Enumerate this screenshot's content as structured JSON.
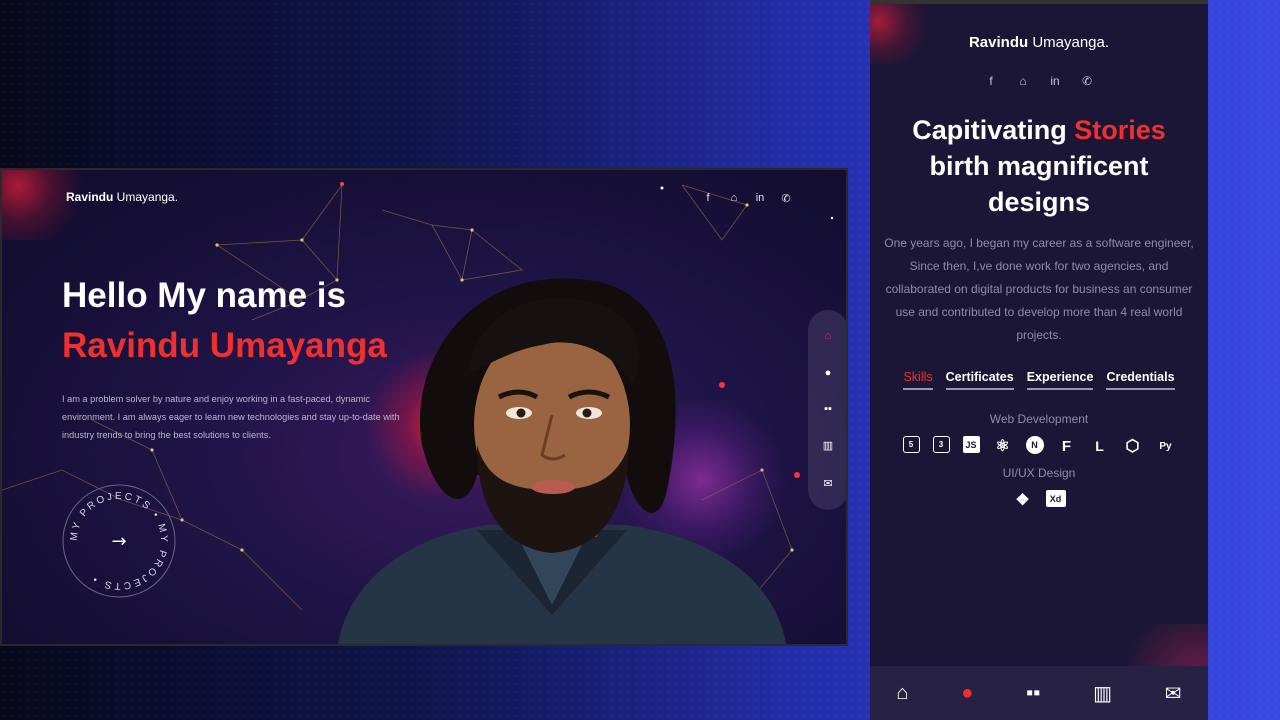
{
  "brand": {
    "first": "Ravindu",
    "last": " Umayanga."
  },
  "social_icons": [
    "facebook-icon",
    "github-icon",
    "linkedin-icon",
    "whatsapp-icon"
  ],
  "social_glyphs": {
    "facebook": "f",
    "github": "⌂",
    "linkedin": "in",
    "whatsapp": "✆"
  },
  "desktop": {
    "hero": {
      "hello": "Hello My name is",
      "name": "Ravindu Umayanga",
      "description": "I am a problem solver by nature and enjoy working in a fast-paced, dynamic environment. I am always eager to learn new technologies and stay up-to-date with industry trends to bring the best solutions to clients."
    },
    "projects_badge": {
      "ring_text": "MY PROJECTS • MY PROJECTS •",
      "arrow": "→"
    },
    "side_nav": [
      {
        "icon": "home-icon",
        "glyph": "⌂",
        "active": true
      },
      {
        "icon": "user-icon",
        "glyph": "●",
        "active": false
      },
      {
        "icon": "services-icon",
        "glyph": "▪▪",
        "active": false
      },
      {
        "icon": "portfolio-icon",
        "glyph": "▥",
        "active": false
      },
      {
        "icon": "mail-icon",
        "glyph": "✉",
        "active": false
      }
    ]
  },
  "mobile": {
    "title_line1_white": "Capitivating ",
    "title_line1_red": "Stories",
    "title_line2": "birth magnificent",
    "title_line3": "designs",
    "description": "One years ago, I began my career as a software engineer, Since then, I,ve done work for two agencies, and collaborated on digital products for business an consumer use and contributed to develop more than 4 real world projects.",
    "tabs": [
      {
        "label": "Skills",
        "active": true
      },
      {
        "label": "Certificates",
        "active": false
      },
      {
        "label": "Experience",
        "active": false
      },
      {
        "label": "Credentials",
        "active": false
      }
    ],
    "web_dev": {
      "heading": "Web Development",
      "skills": [
        {
          "icon": "html5-icon",
          "glyph": "5"
        },
        {
          "icon": "css3-icon",
          "glyph": "3"
        },
        {
          "icon": "javascript-icon",
          "glyph": "JS"
        },
        {
          "icon": "react-icon",
          "glyph": "⚛"
        },
        {
          "icon": "nextjs-icon",
          "glyph": "N"
        },
        {
          "icon": "framer-icon",
          "glyph": "F"
        },
        {
          "icon": "laravel-icon",
          "glyph": "L"
        },
        {
          "icon": "nodejs-icon",
          "glyph": "⬡"
        },
        {
          "icon": "python-icon",
          "glyph": "Py"
        }
      ]
    },
    "uiux": {
      "heading": "UI/UX Design",
      "skills": [
        {
          "icon": "figma-icon",
          "glyph": "❖"
        },
        {
          "icon": "adobe-xd-icon",
          "glyph": "Xd"
        }
      ]
    },
    "bottom_nav": [
      {
        "icon": "home-icon",
        "glyph": "⌂",
        "active": false
      },
      {
        "icon": "user-icon",
        "glyph": "●",
        "active": true
      },
      {
        "icon": "services-icon",
        "glyph": "▪▪",
        "active": false
      },
      {
        "icon": "portfolio-icon",
        "glyph": "▥",
        "active": false
      },
      {
        "icon": "mail-icon",
        "glyph": "✉",
        "active": false
      }
    ]
  },
  "colors": {
    "accent": "#f0302e",
    "panel": "#1b1636",
    "background_blue": "#2c3ad0"
  }
}
